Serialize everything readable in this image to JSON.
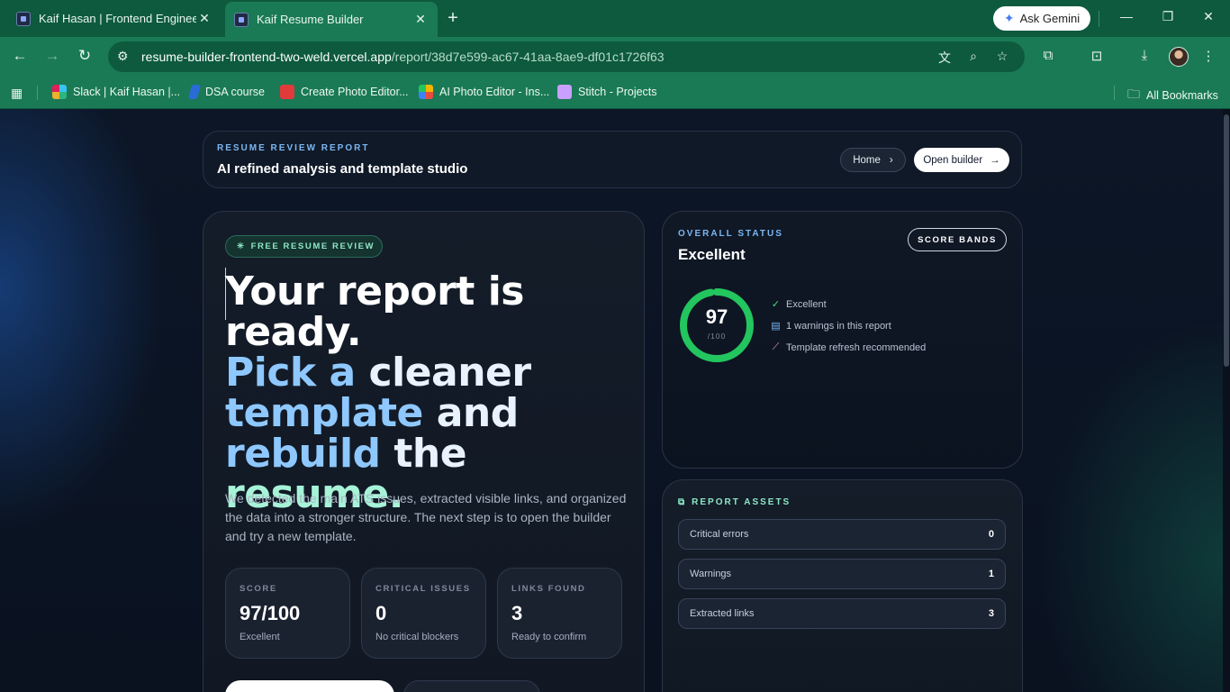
{
  "browser": {
    "tabs": [
      {
        "title": "Kaif Hasan | Frontend Engineer",
        "active": false
      },
      {
        "title": "Kaif Resume Builder",
        "active": true
      }
    ],
    "ask_gemini": "Ask Gemini",
    "url_host": "resume-builder-frontend-two-weld.vercel.app",
    "url_path": "/report/38d7e599-ac67-41aa-8ae9-df01c1726f63",
    "bookmarks": [
      {
        "label": "Slack | Kaif Hasan |...",
        "color": "#e01e5a"
      },
      {
        "label": "DSA course",
        "color": "#2b6bd6"
      },
      {
        "label": "Create Photo Editor...",
        "color": "#e03a3a"
      },
      {
        "label": "AI Photo Editor - Ins...",
        "color": "#f2b500"
      },
      {
        "label": "Stitch - Projects",
        "color": "#c9a0ff"
      }
    ],
    "all_bookmarks": "All Bookmarks"
  },
  "header": {
    "eyebrow": "RESUME REVIEW REPORT",
    "title": "AI refined analysis and template studio",
    "home_label": "Home",
    "builder_label": "Open builder"
  },
  "hero": {
    "pill": "FREE RESUME REVIEW",
    "headline": {
      "line1": "Your report is",
      "line2": "ready.",
      "pick": "Pick a",
      "cleaner": " cleaner",
      "template": "template",
      "and": " and",
      "rebuild": "rebuild",
      "the": " the",
      "resume": " resume."
    },
    "description": "We detected the main ATS issues, extracted visible links, and organized the data into a stronger structure. The next step is to open the builder and try a new template.",
    "stats": [
      {
        "label": "SCORE",
        "value": "97/100",
        "sub": "Excellent"
      },
      {
        "label": "CRITICAL ISSUES",
        "value": "0",
        "sub": "No critical blockers"
      },
      {
        "label": "LINKS FOUND",
        "value": "3",
        "sub": "Ready to confirm"
      }
    ]
  },
  "status": {
    "eyebrow": "OVERALL STATUS",
    "title": "Excellent",
    "bands_label": "SCORE BANDS",
    "score": 97,
    "score_max": "/100",
    "lines": [
      "Excellent",
      "1 warnings in this report",
      "Template refresh recommended"
    ],
    "accent": "#22c55e"
  },
  "assets": {
    "eyebrow": "REPORT ASSETS",
    "rows": [
      {
        "label": "Critical errors",
        "count": "0"
      },
      {
        "label": "Warnings",
        "count": "1"
      },
      {
        "label": "Extracted links",
        "count": "3"
      }
    ]
  }
}
